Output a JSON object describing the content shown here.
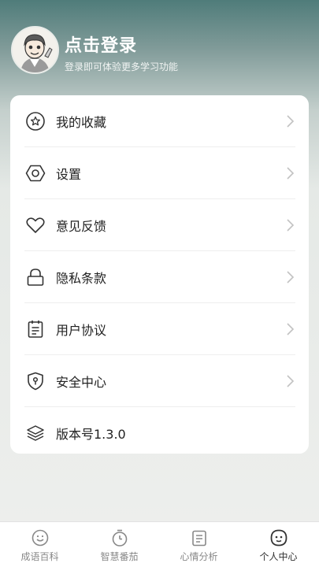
{
  "header": {
    "title": "点击登录",
    "subtitle": "登录即可体验更多学习功能"
  },
  "menu": {
    "items": [
      {
        "label": "我的收藏",
        "icon": "star-icon",
        "has_arrow": true
      },
      {
        "label": "设置",
        "icon": "hexagon-nut-icon",
        "has_arrow": true
      },
      {
        "label": "意见反馈",
        "icon": "heart-icon",
        "has_arrow": true
      },
      {
        "label": "隐私条款",
        "icon": "lock-icon",
        "has_arrow": true
      },
      {
        "label": "用户协议",
        "icon": "document-icon",
        "has_arrow": true
      },
      {
        "label": "安全中心",
        "icon": "shield-icon",
        "has_arrow": true
      },
      {
        "label": "版本号1.3.0",
        "icon": "layers-icon",
        "has_arrow": false
      }
    ]
  },
  "tabbar": {
    "tabs": [
      {
        "label": "成语百科",
        "icon": "smiley-icon",
        "active": false
      },
      {
        "label": "智慧番茄",
        "icon": "timer-icon",
        "active": false
      },
      {
        "label": "心情分析",
        "icon": "notepad-icon",
        "active": false
      },
      {
        "label": "个人中心",
        "icon": "face-icon",
        "active": true
      }
    ]
  },
  "colors": {
    "header_top": "#4f7c7a",
    "card_bg": "#ffffff",
    "text_primary": "#222222",
    "text_muted": "#888888"
  }
}
